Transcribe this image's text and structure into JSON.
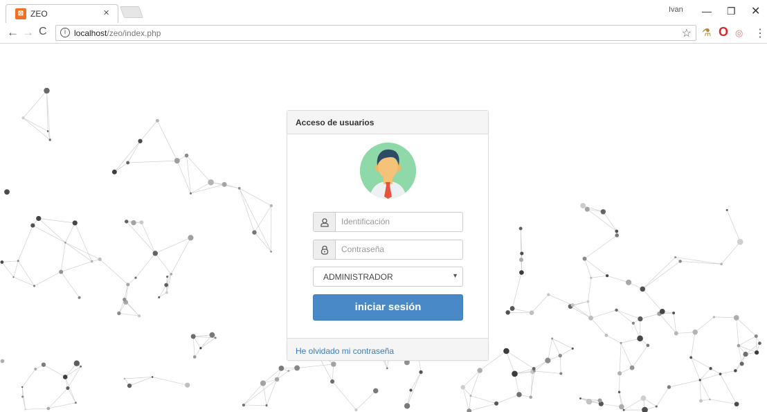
{
  "browser": {
    "tab_title": "ZEO",
    "tab_favicon": "xampp-icon",
    "tab_close": "×",
    "url_host": "localhost",
    "url_path": "/zeo/index.php",
    "profile_label": "Ivan"
  },
  "login": {
    "heading": "Acceso de usuarios",
    "id_placeholder": "Identificación",
    "password_placeholder": "Contraseña",
    "role_selected": "ADMINISTRADOR",
    "submit_label": "iniciar sesión",
    "forgot_link": "He olvidado mi contraseña"
  },
  "colors": {
    "accent": "#4a89c7",
    "link": "#3a7dc0",
    "avatar_bg": "#8fd8a8"
  }
}
